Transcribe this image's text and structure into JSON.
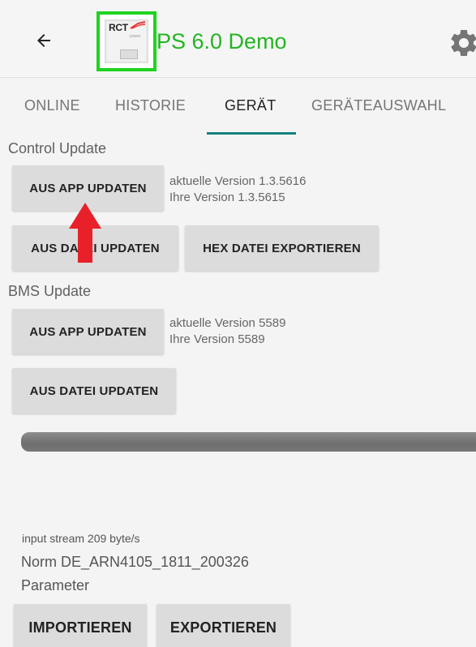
{
  "app_bar": {
    "title": "PS 6.0 Demo",
    "logo_text": "RCT",
    "logo_subtext": "power",
    "back_icon": "arrow-left-icon",
    "settings_icon": "gear-icon",
    "title_color": "#22b522",
    "logo_border_color": "#1fd31f"
  },
  "tabs": [
    {
      "label": "ONLINE",
      "active": false
    },
    {
      "label": "HISTORIE",
      "active": false
    },
    {
      "label": "GERÄT",
      "active": true
    },
    {
      "label": "GERÄTEAUSWAHL",
      "active": false
    }
  ],
  "accent_color": "#14827c",
  "control_update": {
    "title": "Control Update",
    "app_update_label": "AUS APP UPDATEN",
    "current_version": "aktuelle Version 1.3.5616",
    "your_version": "Ihre Version 1.3.5615",
    "file_update_label": "AUS DATEI UPDATEN",
    "hex_export_label": "HEX DATEI EXPORTIEREN"
  },
  "bms_update": {
    "title": "BMS Update",
    "app_update_label": "AUS APP UPDATEN",
    "current_version": "aktuelle Version 5589",
    "your_version": "Ihre Version 5589",
    "file_update_label": "AUS DATEI UPDATEN"
  },
  "annotation": {
    "arrow_color": "#e8202a",
    "arrow_icon": "red-up-arrow-icon"
  },
  "status": {
    "input_stream": "input stream 209 byte/s",
    "norm": "Norm DE_ARN4105_1811_200326",
    "parameter_label": "Parameter"
  },
  "parameter_actions": {
    "import_label": "IMPORTIEREN",
    "export_label": "EXPORTIEREN"
  }
}
